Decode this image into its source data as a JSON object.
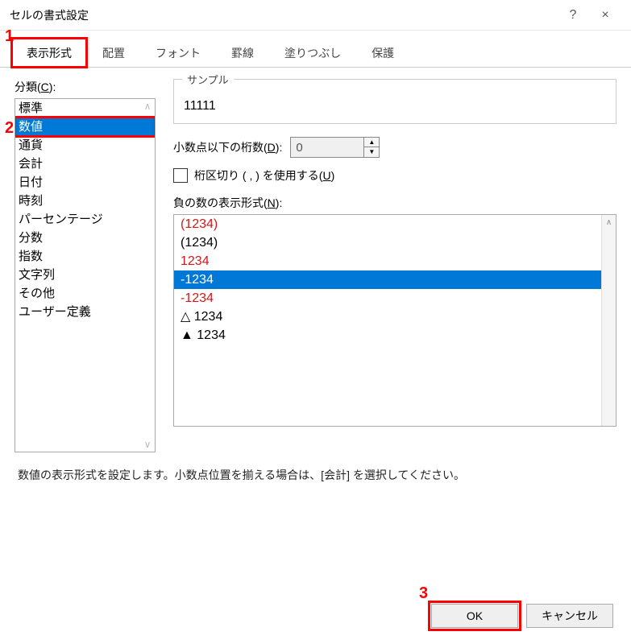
{
  "title": "セルの書式設定",
  "titlebar": {
    "help": "?",
    "close": "×"
  },
  "annotations": {
    "a1": "1",
    "a2": "2",
    "a3": "3"
  },
  "tabs": [
    "表示形式",
    "配置",
    "フォント",
    "罫線",
    "塗りつぶし",
    "保護"
  ],
  "category": {
    "label_pre": "分類(",
    "label_u": "C",
    "label_post": "):",
    "items": [
      "標準",
      "数値",
      "通貨",
      "会計",
      "日付",
      "時刻",
      "パーセンテージ",
      "分数",
      "指数",
      "文字列",
      "その他",
      "ユーザー定義"
    ],
    "selected_index": 1
  },
  "sample": {
    "legend": "サンプル",
    "value": "11111"
  },
  "decimals": {
    "label_pre": "小数点以下の桁数(",
    "label_u": "D",
    "label_post": "):",
    "value": "0"
  },
  "separator": {
    "label_pre": "桁区切り ( , ) を使用する(",
    "label_u": "U",
    "label_post": ")"
  },
  "negative": {
    "label_pre": "負の数の表示形式(",
    "label_u": "N",
    "label_post": "):",
    "items": [
      {
        "text": "(1234)",
        "red": true
      },
      {
        "text": "(1234)",
        "red": false
      },
      {
        "text": "1234",
        "red": true
      },
      {
        "text": "-1234",
        "red": false,
        "selected": true
      },
      {
        "text": "-1234",
        "red": true
      },
      {
        "text": "△ 1234",
        "red": false
      },
      {
        "text": "▲ 1234",
        "red": false
      }
    ]
  },
  "description": "数値の表示形式を設定します。小数点位置を揃える場合は、[会計] を選択してください。",
  "buttons": {
    "ok": "OK",
    "cancel": "キャンセル"
  }
}
